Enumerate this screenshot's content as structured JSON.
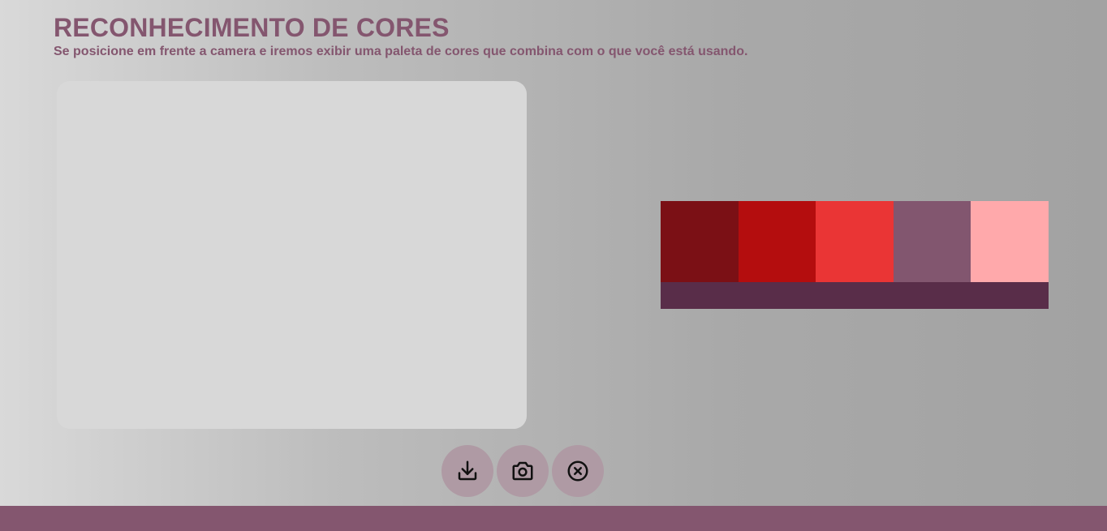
{
  "header": {
    "title": "RECONHECIMENTO DE CORES",
    "subtitle": "Se posicione em frente a camera e iremos exibir uma paleta de cores que combina com o que você está usando."
  },
  "palette": {
    "swatches": [
      "#7b1015",
      "#b40d0e",
      "#ea3535",
      "#82566f",
      "#ffa9ab"
    ],
    "bar_color": "#592d49"
  },
  "controls": [
    {
      "name": "download-button",
      "icon": "download-icon"
    },
    {
      "name": "capture-button",
      "icon": "camera-icon"
    },
    {
      "name": "close-button",
      "icon": "close-circle-icon"
    }
  ],
  "colors": {
    "accent": "#84566f",
    "button_bg": "#af9aa4",
    "preview_bg": "#d8d8d8"
  }
}
